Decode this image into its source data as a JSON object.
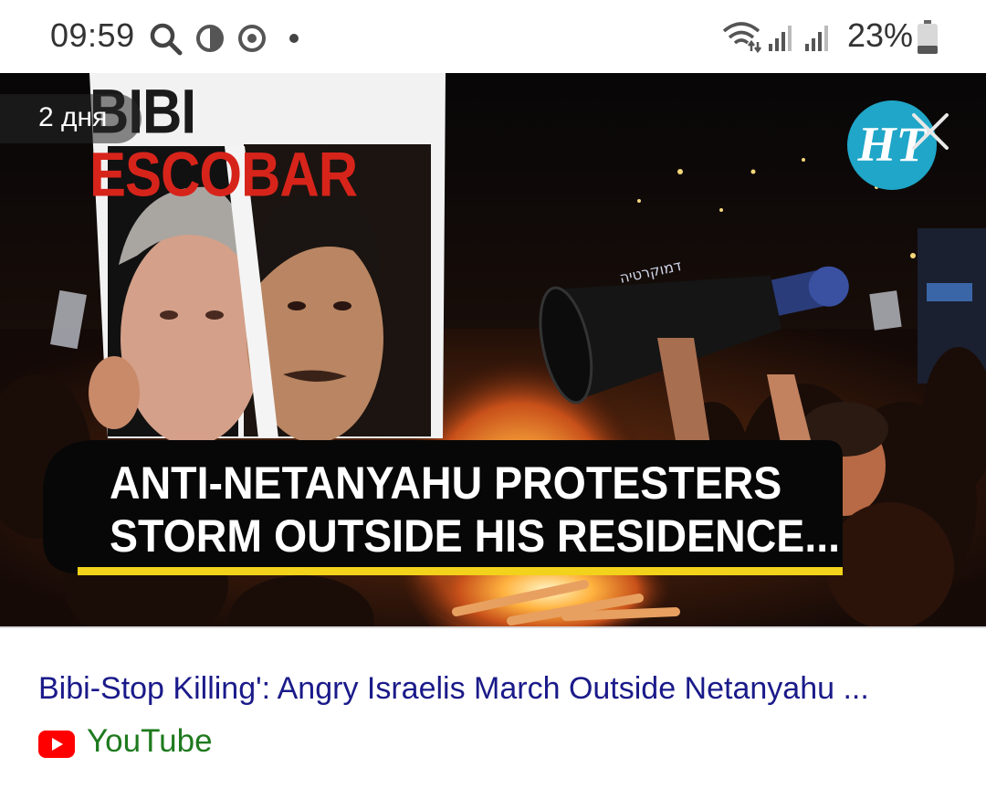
{
  "status_bar": {
    "time": "09:59",
    "battery": "23%",
    "icons": [
      "search-icon",
      "data-saver-icon",
      "sync-icon",
      "dot-icon",
      "wifi-icon",
      "signal-icon",
      "signal-icon",
      "battery-icon"
    ]
  },
  "result": {
    "age": "2 дня",
    "sign_word1": "BIBI",
    "sign_word2": "ESCOBAR",
    "headline_line1": "ANTI-NETANYAHU PROTESTERS",
    "headline_line2": "STORM OUTSIDE HIS RESIDENCE...",
    "logo_text": "HT",
    "title": "Bibi-Stop Killing': Angry Israelis March Outside Netanyahu ...",
    "source": "YouTube"
  },
  "colors": {
    "title": "#1a1a8a",
    "source": "#1e7a1e",
    "youtube_red": "#ff0000",
    "logo_blue": "#1fa6c8",
    "headline_underline": "#f2d21b"
  }
}
